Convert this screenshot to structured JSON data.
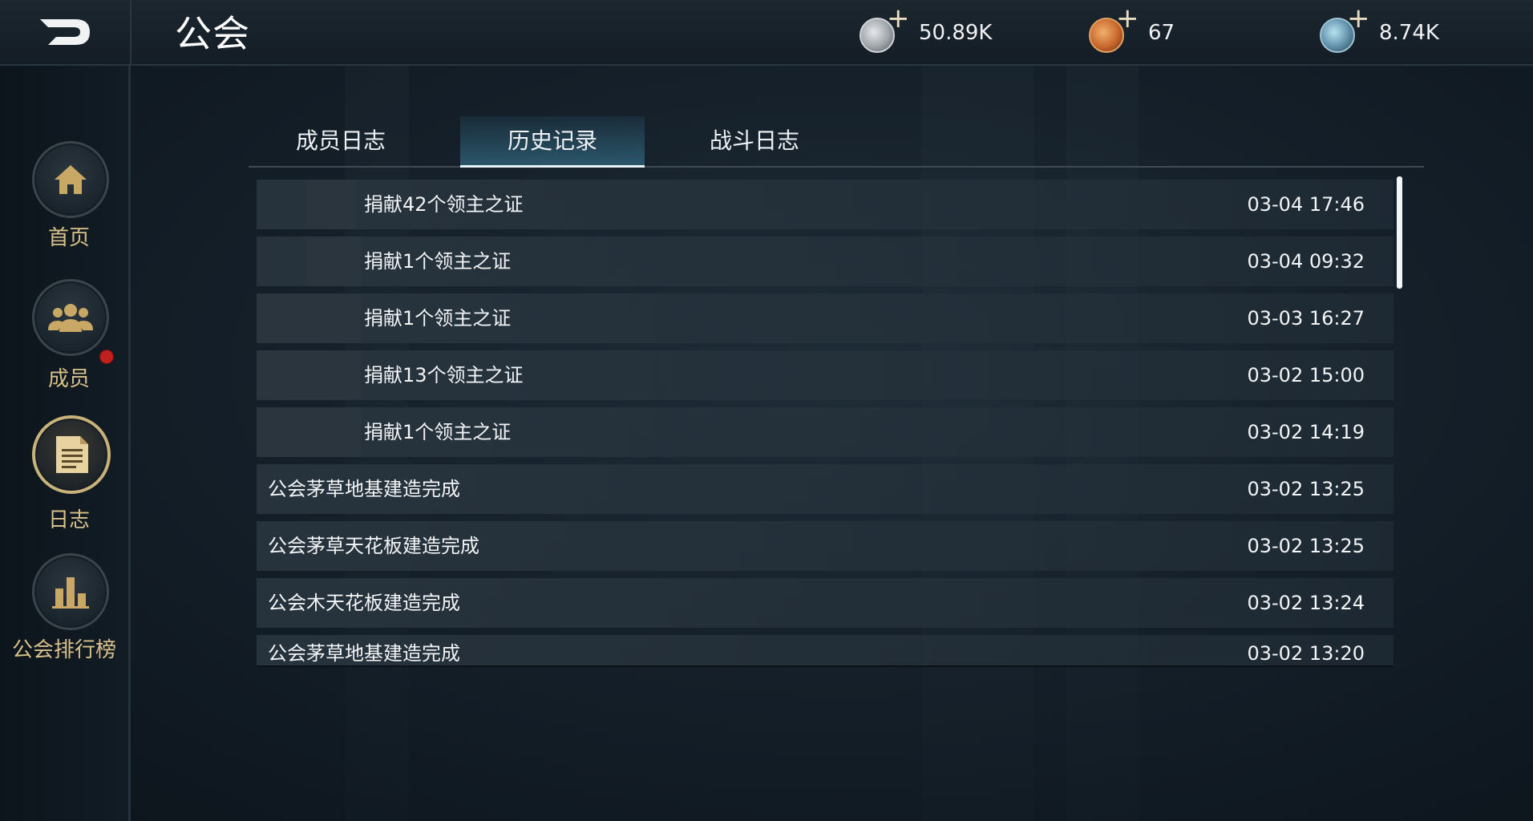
{
  "header": {
    "title": "公会",
    "back_icon": "back-arrow-icon",
    "currencies": [
      {
        "icon": "silver-coin-icon",
        "color": "#b8bcc0",
        "amount": "50.89K"
      },
      {
        "icon": "bronze-coin-icon",
        "color": "#c8672c",
        "amount": "67"
      },
      {
        "icon": "crystal-coin-icon",
        "color": "#5f8fa8",
        "amount": "8.74K"
      }
    ]
  },
  "sidebar": {
    "items": [
      {
        "label": "首页",
        "icon": "home-icon"
      },
      {
        "label": "成员",
        "icon": "members-icon",
        "notification": true
      },
      {
        "label": "日志",
        "icon": "log-icon",
        "active": true
      },
      {
        "label": "公会排行榜",
        "icon": "ranking-icon"
      }
    ]
  },
  "tabs": [
    {
      "label": "成员日志"
    },
    {
      "label": "历史记录",
      "active": true
    },
    {
      "label": "战斗日志"
    }
  ],
  "records": [
    {
      "text": "捐献42个领主之证",
      "time": "03-04 17:46"
    },
    {
      "text": "捐献1个领主之证",
      "time": "03-04 09:32"
    },
    {
      "text": "捐献1个领主之证",
      "time": "03-03 16:27"
    },
    {
      "text": "捐献13个领主之证",
      "time": "03-02 15:00"
    },
    {
      "text": "捐献1个领主之证",
      "time": "03-02 14:19"
    },
    {
      "text": "公会茅草地基建造完成",
      "time": "03-02 13:25"
    },
    {
      "text": "公会茅草天花板建造完成",
      "time": "03-02 13:25"
    },
    {
      "text": "公会木天花板建造完成",
      "time": "03-02 13:24"
    },
    {
      "text": "公会茅草地基建造完成",
      "time": "03-02 13:20"
    }
  ],
  "colors": {
    "accent_gold": "#d8c08a",
    "active_tab": "#3c82a0",
    "notification": "#c0201e"
  }
}
